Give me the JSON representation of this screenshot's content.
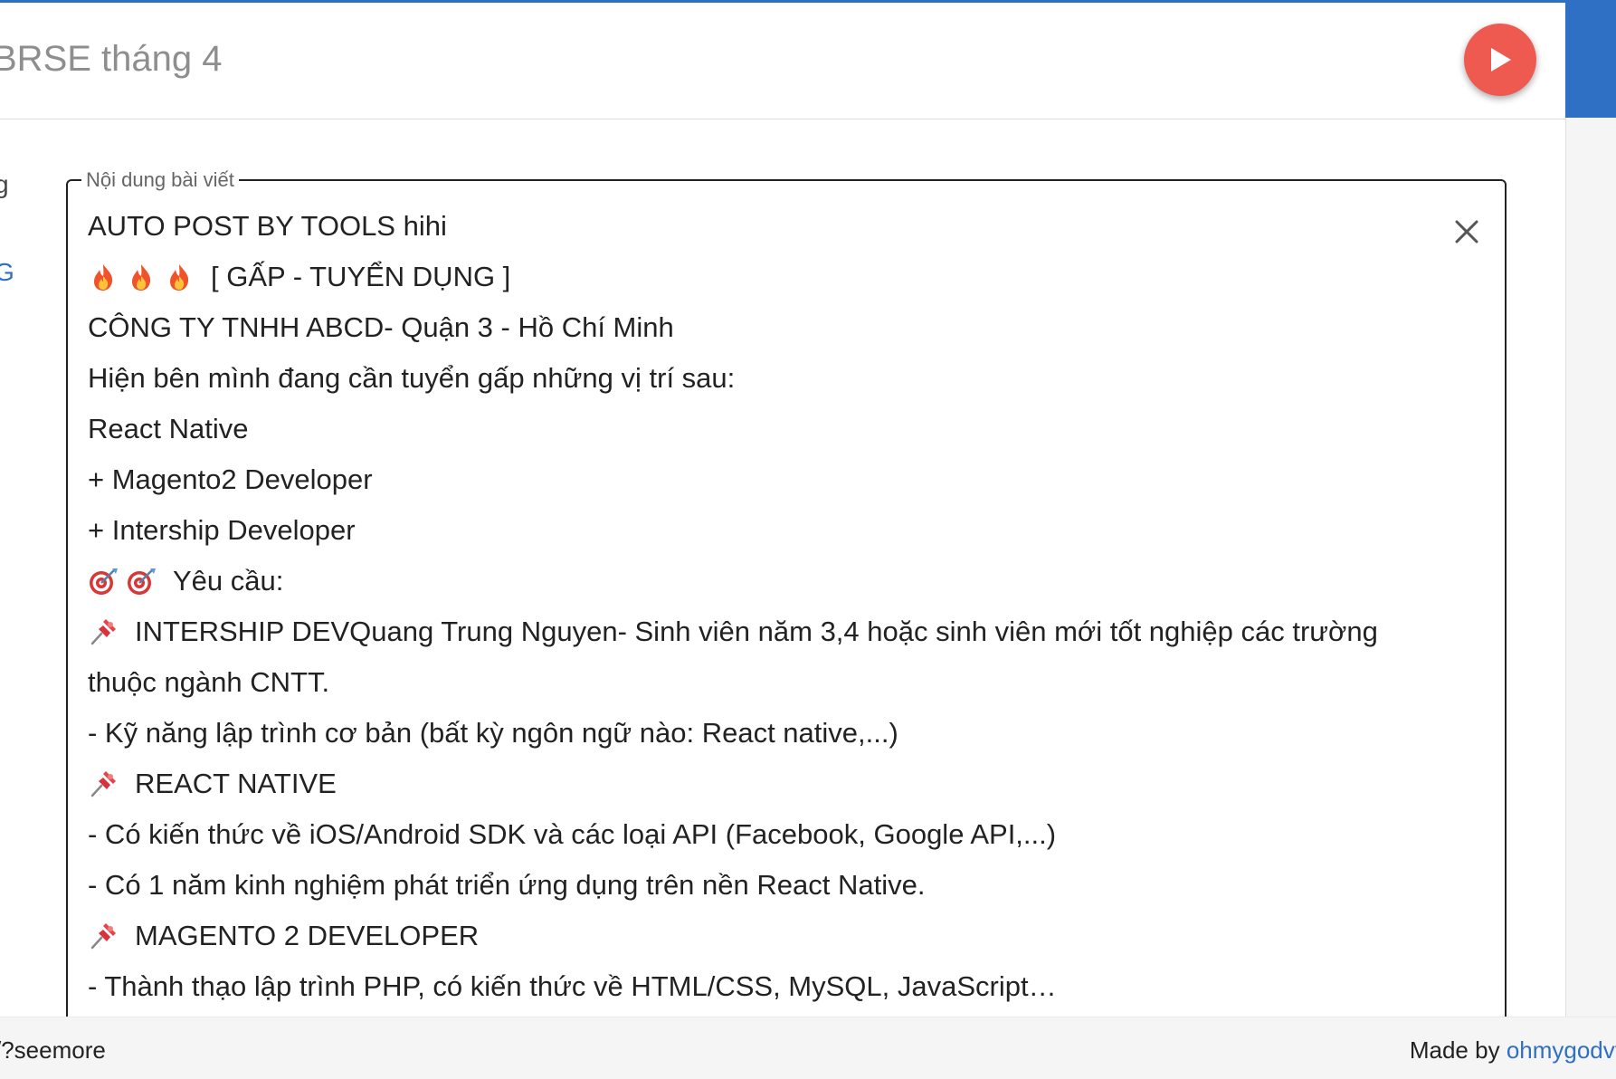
{
  "window": {
    "title": "BRSE tháng 4"
  },
  "side_fragments": {
    "first": "g",
    "second": "G"
  },
  "editor": {
    "legend": "Nội dung bài viết",
    "lines": [
      {
        "emoji": [],
        "text": "AUTO POST BY TOOLS hihi"
      },
      {
        "emoji": [
          "fire-emoji",
          "fire-emoji",
          "fire-emoji"
        ],
        "text": "[ GẤP - TUYỂN DỤNG ]"
      },
      {
        "emoji": [],
        "text": "CÔNG TY TNHH ABCD- Quận 3 - Hồ Chí Minh"
      },
      {
        "emoji": [],
        "text": "Hiện bên mình đang cần tuyển gấp những vị trí sau:"
      },
      {
        "emoji": [],
        "text": "React Native"
      },
      {
        "emoji": [],
        "text": "+ Magento2 Developer"
      },
      {
        "emoji": [],
        "text": "+ Intership Developer"
      },
      {
        "emoji": [
          "target-emoji",
          "target-emoji"
        ],
        "text": "Yêu cầu:"
      },
      {
        "emoji": [
          "pin-emoji"
        ],
        "text": "INTERSHIP DEVQuang Trung Nguyen- Sinh viên năm 3,4 hoặc sinh viên mới tốt nghiệp các trường"
      },
      {
        "emoji": [],
        "text": "thuộc ngành CNTT."
      },
      {
        "emoji": [],
        "text": "- Kỹ năng lập trình cơ bản (bất kỳ ngôn ngữ nào: React native,...)"
      },
      {
        "emoji": [
          "pin-emoji"
        ],
        "text": "REACT NATIVE"
      },
      {
        "emoji": [],
        "text": "- Có kiến thức về iOS/Android SDK và các loại API (Facebook, Google API,...)"
      },
      {
        "emoji": [],
        "text": "- Có 1 năm kinh nghiệm phát triển ứng dụng trên nền React Native."
      },
      {
        "emoji": [
          "pin-emoji"
        ],
        "text": "MAGENTO 2 DEVELOPER"
      },
      {
        "emoji": [],
        "text": "- Thành thạo lập trình PHP, có kiến thức về HTML/CSS, MySQL, JavaScript…"
      }
    ]
  },
  "footer": {
    "left_text": "/?seemore",
    "made_by_label": "Made by",
    "made_by_link": "ohmygodvt"
  },
  "colors": {
    "accent": "#2f6fc4",
    "play_button": "#ef5a50"
  }
}
